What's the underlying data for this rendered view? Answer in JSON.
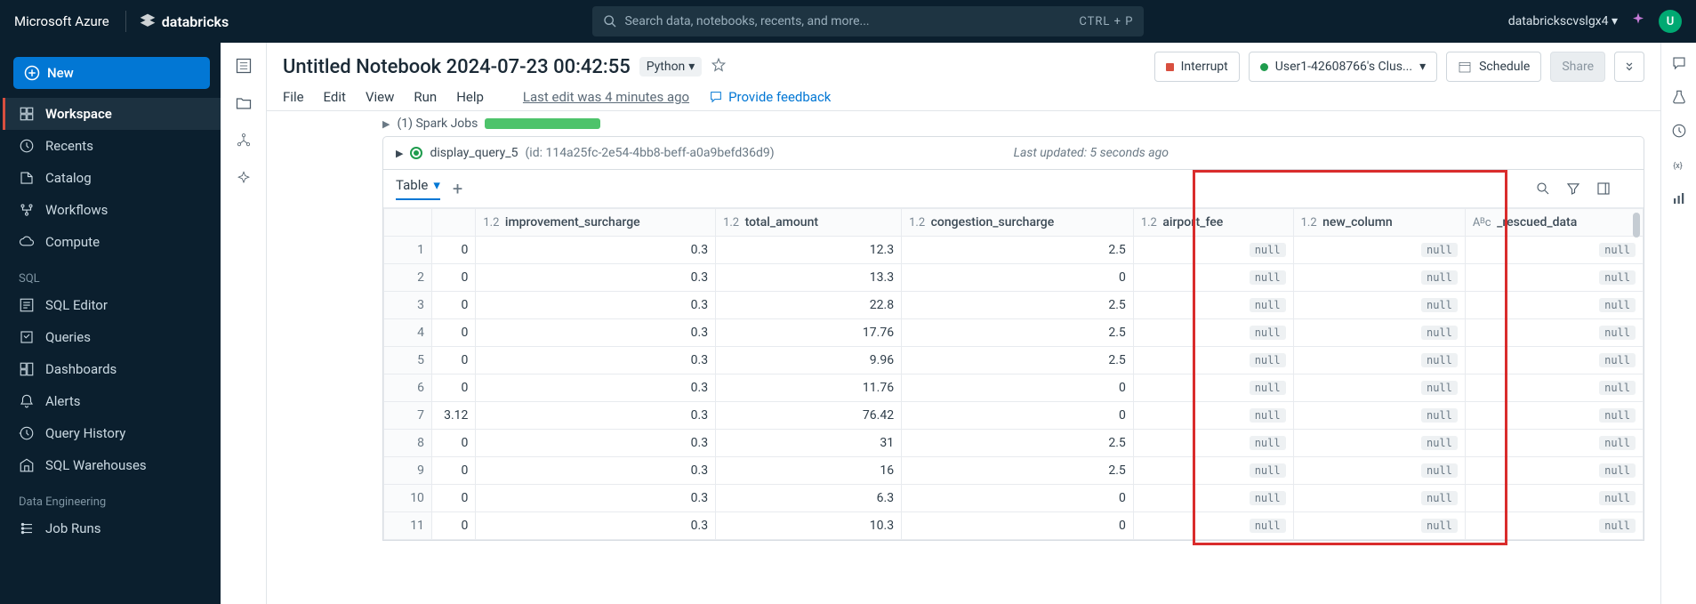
{
  "topbar": {
    "brand": "Microsoft Azure",
    "product": "databricks",
    "search_placeholder": "Search data, notebooks, recents, and more...",
    "search_shortcut": "CTRL + P",
    "workspace": "databrickscvslgx4",
    "avatar_letter": "U"
  },
  "sidebar": {
    "new_label": "New",
    "items_top": [
      {
        "label": "Workspace",
        "icon": "workspace",
        "active": true
      },
      {
        "label": "Recents",
        "icon": "clock"
      },
      {
        "label": "Catalog",
        "icon": "catalog"
      },
      {
        "label": "Workflows",
        "icon": "workflows"
      },
      {
        "label": "Compute",
        "icon": "cloud"
      }
    ],
    "section_sql": "SQL",
    "items_sql": [
      {
        "label": "SQL Editor",
        "icon": "editor"
      },
      {
        "label": "Queries",
        "icon": "queries"
      },
      {
        "label": "Dashboards",
        "icon": "dashboards"
      },
      {
        "label": "Alerts",
        "icon": "alerts"
      },
      {
        "label": "Query History",
        "icon": "history"
      },
      {
        "label": "SQL Warehouses",
        "icon": "warehouse"
      }
    ],
    "section_de": "Data Engineering",
    "items_de": [
      {
        "label": "Job Runs",
        "icon": "jobruns"
      }
    ]
  },
  "notebook": {
    "title": "Untitled Notebook 2024-07-23 00:42:55",
    "language": "Python",
    "menus": [
      "File",
      "Edit",
      "View",
      "Run",
      "Help"
    ],
    "last_edit": "Last edit was 4 minutes ago",
    "feedback": "Provide feedback",
    "interrupt": "Interrupt",
    "cluster": "User1-42608766's Clus...",
    "schedule": "Schedule",
    "share": "Share"
  },
  "cell": {
    "spark_jobs": "(1) Spark Jobs",
    "query_name": "display_query_5",
    "query_id": "(id: 114a25fc-2e54-4bb8-beff-a0a9befd36d9)",
    "last_updated": "Last updated: 5 seconds ago",
    "tab_label": "Table",
    "columns": [
      {
        "type": "",
        "name": ""
      },
      {
        "type": "1.2",
        "name": "improvement_surcharge"
      },
      {
        "type": "1.2",
        "name": "total_amount"
      },
      {
        "type": "1.2",
        "name": "congestion_surcharge"
      },
      {
        "type": "1.2",
        "name": "airport_fee"
      },
      {
        "type": "1.2",
        "name": "new_column"
      },
      {
        "type": "Aᴮc",
        "name": "_rescued_data"
      }
    ],
    "rows": [
      {
        "idx": 1,
        "c0": "0",
        "c1": "0.3",
        "c2": "12.3",
        "c3": "2.5",
        "c4": "null",
        "c5": "null",
        "c6": "null"
      },
      {
        "idx": 2,
        "c0": "0",
        "c1": "0.3",
        "c2": "13.3",
        "c3": "0",
        "c4": "null",
        "c5": "null",
        "c6": "null"
      },
      {
        "idx": 3,
        "c0": "0",
        "c1": "0.3",
        "c2": "22.8",
        "c3": "2.5",
        "c4": "null",
        "c5": "null",
        "c6": "null"
      },
      {
        "idx": 4,
        "c0": "0",
        "c1": "0.3",
        "c2": "17.76",
        "c3": "2.5",
        "c4": "null",
        "c5": "null",
        "c6": "null"
      },
      {
        "idx": 5,
        "c0": "0",
        "c1": "0.3",
        "c2": "9.96",
        "c3": "2.5",
        "c4": "null",
        "c5": "null",
        "c6": "null"
      },
      {
        "idx": 6,
        "c0": "0",
        "c1": "0.3",
        "c2": "11.76",
        "c3": "0",
        "c4": "null",
        "c5": "null",
        "c6": "null"
      },
      {
        "idx": 7,
        "c0": "3.12",
        "c1": "0.3",
        "c2": "76.42",
        "c3": "0",
        "c4": "null",
        "c5": "null",
        "c6": "null"
      },
      {
        "idx": 8,
        "c0": "0",
        "c1": "0.3",
        "c2": "31",
        "c3": "2.5",
        "c4": "null",
        "c5": "null",
        "c6": "null"
      },
      {
        "idx": 9,
        "c0": "0",
        "c1": "0.3",
        "c2": "16",
        "c3": "2.5",
        "c4": "null",
        "c5": "null",
        "c6": "null"
      },
      {
        "idx": 10,
        "c0": "0",
        "c1": "0.3",
        "c2": "6.3",
        "c3": "0",
        "c4": "null",
        "c5": "null",
        "c6": "null"
      },
      {
        "idx": 11,
        "c0": "0",
        "c1": "0.3",
        "c2": "10.3",
        "c3": "0",
        "c4": "null",
        "c5": "null",
        "c6": "null"
      }
    ]
  }
}
